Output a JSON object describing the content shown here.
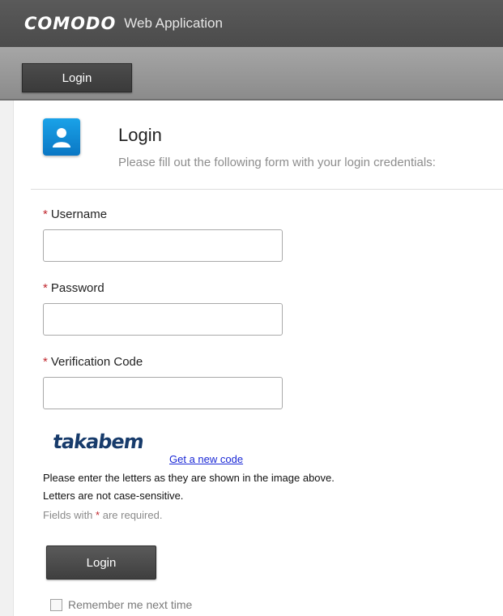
{
  "app": {
    "brand": "COMODO",
    "subtitle": "Web Application"
  },
  "nav": {
    "login_tab": "Login"
  },
  "header": {
    "title": "Login",
    "subtitle": "Please fill out the following form with your login credentials:",
    "icon": "user-icon"
  },
  "form": {
    "required_mark": "*",
    "username": {
      "label": "Username",
      "value": ""
    },
    "password": {
      "label": "Password",
      "value": ""
    },
    "verification": {
      "label": "Verification Code",
      "value": ""
    },
    "captcha_text": "takabem",
    "new_code_link": "Get a new code",
    "hint_line1": "Please enter the letters as they are shown in the image above.",
    "hint_line2": "Letters are not case-sensitive.",
    "required_note_prefix": "Fields with",
    "required_note_suffix": "are required.",
    "submit_label": "Login",
    "remember_label": "Remember me next time",
    "remember_checked": false
  },
  "colors": {
    "accent_blue": "#0f8fd9",
    "required_red": "#c0262d",
    "link_blue": "#1a28d6"
  }
}
